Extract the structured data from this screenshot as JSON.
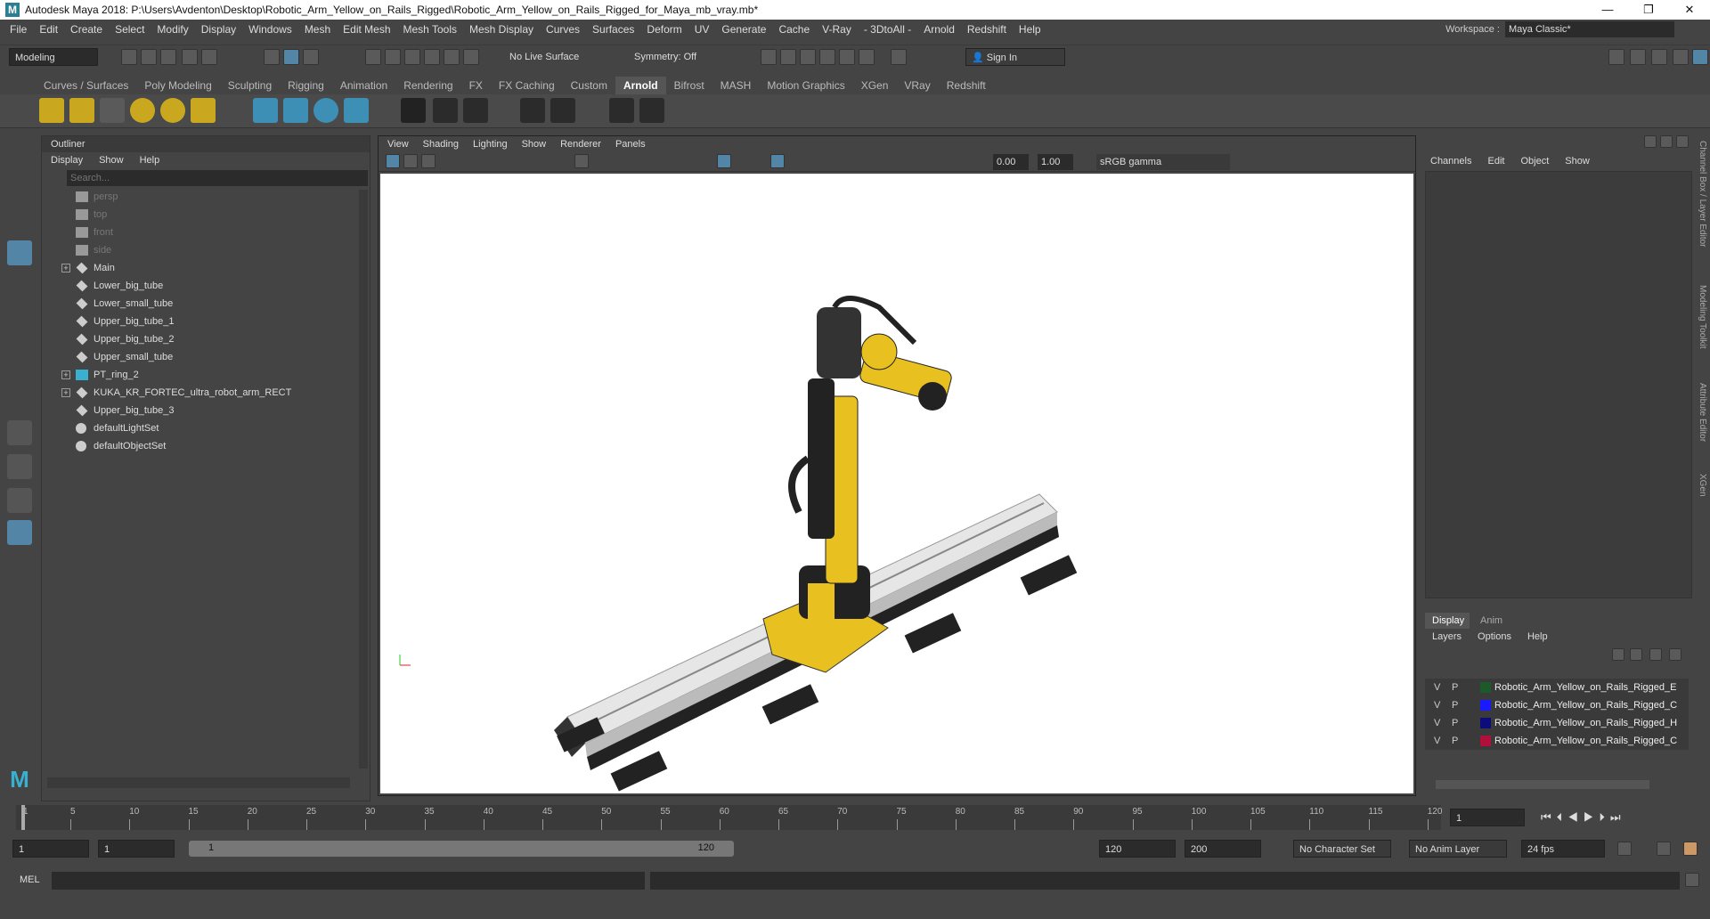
{
  "window": {
    "title": "Autodesk Maya 2018: P:\\Users\\Avdenton\\Desktop\\Robotic_Arm_Yellow_on_Rails_Rigged\\Robotic_Arm_Yellow_on_Rails_Rigged_for_Maya_mb_vray.mb*",
    "minimize": "—",
    "maximize": "❐",
    "close": "✕"
  },
  "menu": [
    "File",
    "Edit",
    "Create",
    "Select",
    "Modify",
    "Display",
    "Windows",
    "Mesh",
    "Edit Mesh",
    "Mesh Tools",
    "Mesh Display",
    "Curves",
    "Surfaces",
    "Deform",
    "UV",
    "Generate",
    "Cache",
    "V-Ray",
    "- 3DtoAll -",
    "Arnold",
    "Redshift",
    "Help"
  ],
  "workspace": {
    "label": "Workspace :",
    "value": "Maya Classic*"
  },
  "statusline": {
    "mode": "Modeling",
    "live_surface": "No Live Surface",
    "symmetry": "Symmetry: Off",
    "sign_in": "Sign In"
  },
  "shelf_tabs": [
    "Curves / Surfaces",
    "Poly Modeling",
    "Sculpting",
    "Rigging",
    "Animation",
    "Rendering",
    "FX",
    "FX Caching",
    "Custom",
    "Arnold",
    "Bifrost",
    "MASH",
    "Motion Graphics",
    "XGen",
    "VRay",
    "Redshift"
  ],
  "active_shelf_tab": "Arnold",
  "outliner": {
    "title": "Outliner",
    "menu": [
      "Display",
      "Show",
      "Help"
    ],
    "search_placeholder": "Search...",
    "items": [
      {
        "label": "persp",
        "type": "camera",
        "dim": true,
        "expand": false
      },
      {
        "label": "top",
        "type": "camera",
        "dim": true,
        "expand": false
      },
      {
        "label": "front",
        "type": "camera",
        "dim": true,
        "expand": false
      },
      {
        "label": "side",
        "type": "camera",
        "dim": true,
        "expand": false
      },
      {
        "label": "Main",
        "type": "transform",
        "dim": false,
        "expand": true
      },
      {
        "label": "Lower_big_tube",
        "type": "transform",
        "dim": false,
        "expand": false
      },
      {
        "label": "Lower_small_tube",
        "type": "transform",
        "dim": false,
        "expand": false
      },
      {
        "label": "Upper_big_tube_1",
        "type": "transform",
        "dim": false,
        "expand": false
      },
      {
        "label": "Upper_big_tube_2",
        "type": "transform",
        "dim": false,
        "expand": false
      },
      {
        "label": "Upper_small_tube",
        "type": "transform",
        "dim": false,
        "expand": false
      },
      {
        "label": "PT_ring_2",
        "type": "joint",
        "dim": false,
        "expand": true
      },
      {
        "label": "KUKA_KR_FORTEC_ultra_robot_arm_RECT",
        "type": "transform",
        "dim": false,
        "expand": true
      },
      {
        "label": "Upper_big_tube_3",
        "type": "transform",
        "dim": false,
        "expand": false
      },
      {
        "label": "defaultLightSet",
        "type": "set",
        "dim": false,
        "expand": false
      },
      {
        "label": "defaultObjectSet",
        "type": "set",
        "dim": false,
        "expand": false
      }
    ]
  },
  "viewport": {
    "menu": [
      "View",
      "Shading",
      "Lighting",
      "Show",
      "Renderer",
      "Panels"
    ],
    "exposure": "0.00",
    "gamma": "1.00",
    "color_space": "sRGB gamma"
  },
  "channel_box": {
    "menu": [
      "Channels",
      "Edit",
      "Object",
      "Show"
    ],
    "layer_tabs": [
      "Display",
      "Anim"
    ],
    "layer_menu": [
      "Layers",
      "Options",
      "Help"
    ],
    "layers": [
      {
        "v": "V",
        "p": "P",
        "color": "#1d5a2a",
        "name": "Robotic_Arm_Yellow_on_Rails_Rigged_E"
      },
      {
        "v": "V",
        "p": "P",
        "color": "#1a1aff",
        "name": "Robotic_Arm_Yellow_on_Rails_Rigged_C"
      },
      {
        "v": "V",
        "p": "P",
        "color": "#0d0d7a",
        "name": "Robotic_Arm_Yellow_on_Rails_Rigged_H"
      },
      {
        "v": "V",
        "p": "P",
        "color": "#b0103a",
        "name": "Robotic_Arm_Yellow_on_Rails_Rigged_C"
      }
    ]
  },
  "side_tabs": [
    "Channel Box / Layer Editor",
    "Modeling Toolkit",
    "Attribute Editor",
    "XGen"
  ],
  "timeline": {
    "ticks": [
      "1",
      "5",
      "10",
      "15",
      "20",
      "25",
      "30",
      "35",
      "40",
      "45",
      "50",
      "55",
      "60",
      "65",
      "70",
      "75",
      "80",
      "85",
      "90",
      "95",
      "100",
      "105",
      "110",
      "115",
      "120"
    ],
    "current_frame": "1"
  },
  "range": {
    "start": "1",
    "playback_start": "1",
    "slider_start": "1",
    "slider_end": "120",
    "playback_end": "120",
    "end": "200",
    "character_set": "No Character Set",
    "anim_layer": "No Anim Layer",
    "fps": "24 fps"
  },
  "command_line": {
    "label": "MEL"
  }
}
